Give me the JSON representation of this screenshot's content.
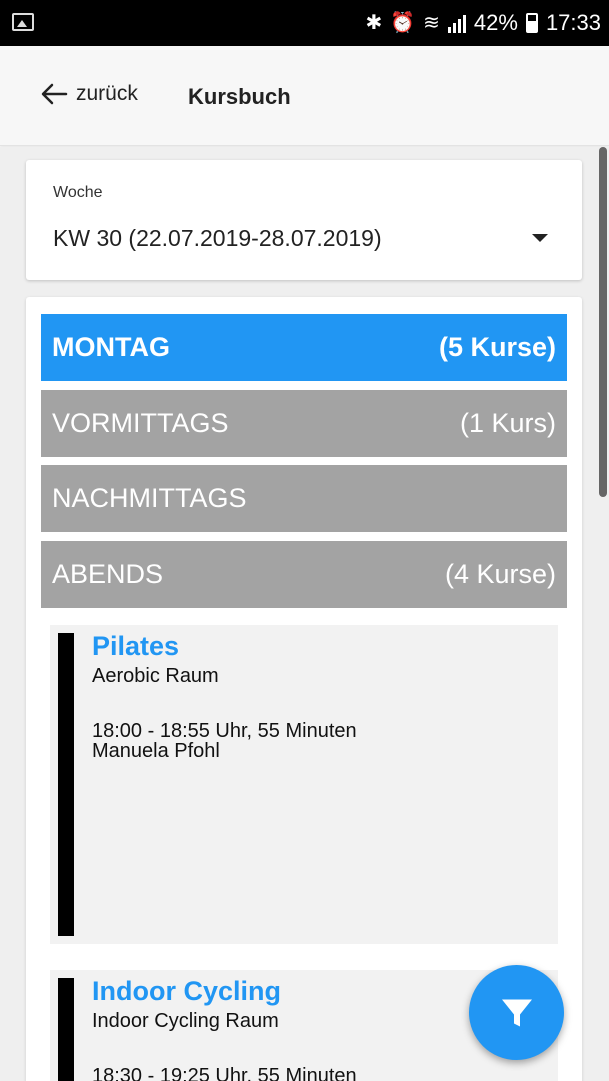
{
  "status_bar": {
    "battery": "42%",
    "time": "17:33",
    "icons": [
      "image-notification-icon",
      "bluetooth-icon",
      "alarm-icon",
      "wifi-icon",
      "signal-icon",
      "battery-icon"
    ]
  },
  "app_bar": {
    "back_label": "zurück",
    "title": "Kursbuch"
  },
  "week_selector": {
    "label": "Woche",
    "value": "KW 30 (22.07.2019-28.07.2019)"
  },
  "day": {
    "name": "MONTAG",
    "count": "(5 Kurse)",
    "sections": [
      {
        "label": "VORMITTAGS",
        "count": "(1 Kurs)"
      },
      {
        "label": "NACHMITTAGS",
        "count": ""
      },
      {
        "label": "ABENDS",
        "count": "(4 Kurse)"
      }
    ]
  },
  "courses": [
    {
      "title": "Pilates",
      "room": "Aerobic Raum",
      "time": "18:00 - 18:55 Uhr, 55 Minuten",
      "trainer": "Manuela Pfohl"
    },
    {
      "title": "Indoor Cycling",
      "room": "Indoor Cycling Raum",
      "time": "18:30 - 19:25 Uhr, 55 Minuten",
      "trainer": ""
    }
  ],
  "colors": {
    "accent": "#2196f3",
    "section_grey": "#a3a3a3",
    "course_bg": "#f2f2f2"
  }
}
